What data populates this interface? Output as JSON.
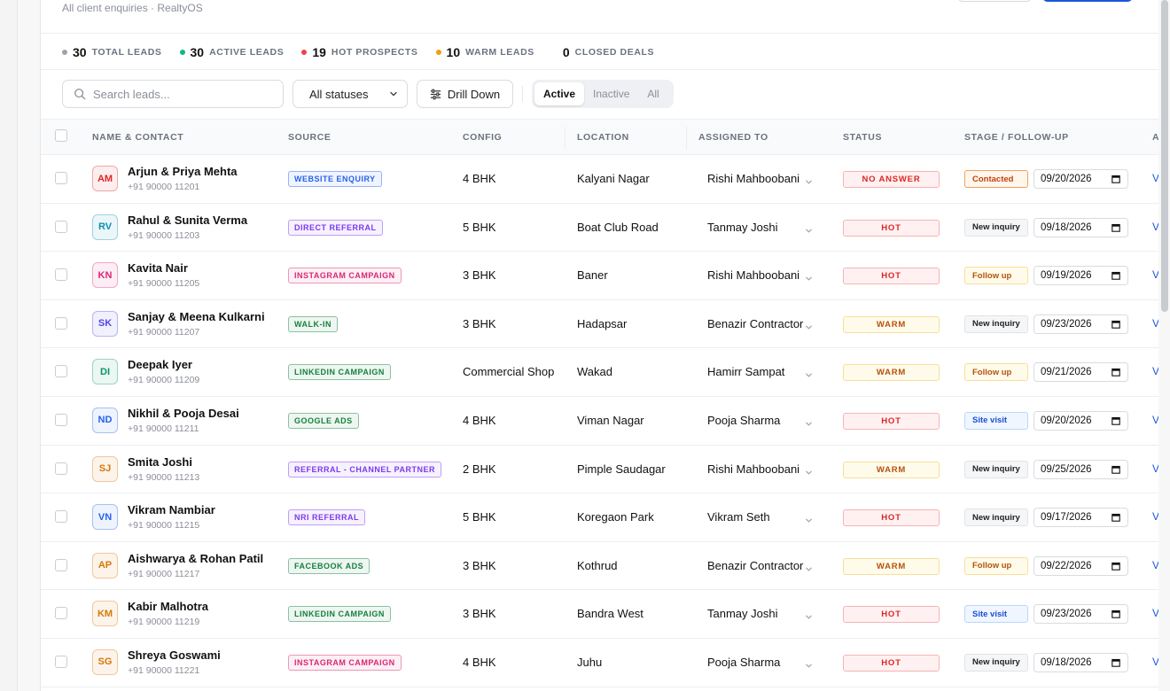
{
  "header": {
    "subtitle": "All client enquiries · RealtyOS"
  },
  "stats": [
    {
      "count": "30",
      "label": "TOTAL LEADS",
      "color": "#9ca3af"
    },
    {
      "count": "30",
      "label": "ACTIVE LEADS",
      "color": "#10b981"
    },
    {
      "count": "19",
      "label": "HOT PROSPECTS",
      "color": "#ef4444"
    },
    {
      "count": "10",
      "label": "WARM LEADS",
      "color": "#f59e0b"
    },
    {
      "count": "0",
      "label": "CLOSED DEALS",
      "color": ""
    }
  ],
  "toolbar": {
    "search_placeholder": "Search leads...",
    "status_filter": "All statuses",
    "drill_down_label": "Drill Down",
    "segments": [
      "Active",
      "Inactive",
      "All"
    ],
    "active_segment": "Active"
  },
  "table": {
    "columns": [
      "NAME & CONTACT",
      "SOURCE",
      "CONFIG",
      "LOCATION",
      "ASSIGNED TO",
      "STATUS",
      "STAGE / FOLLOW-UP",
      "A"
    ],
    "action_label": "V",
    "rows": [
      {
        "initials": "AM",
        "avatar_color": "#dc2626",
        "name": "Arjun & Priya Mehta",
        "phone": "+91 90000 11201",
        "source": "WEBSITE ENQUIRY",
        "source_color": "#2563eb",
        "config": "4 BHK",
        "location": "Kalyani Nagar",
        "assigned": "Rishi Mahboobani",
        "status": "NO ANSWER",
        "status_type": "noans",
        "stage": "Contacted",
        "stage_type": "contacted",
        "date": "09/20/2026"
      },
      {
        "initials": "RV",
        "avatar_color": "#0891b2",
        "name": "Rahul & Sunita Verma",
        "phone": "+91 90000 11203",
        "source": "DIRECT REFERRAL",
        "source_color": "#7c3aed",
        "config": "5 BHK",
        "location": "Boat Club Road",
        "assigned": "Tanmay Joshi",
        "status": "HOT",
        "status_type": "hot",
        "stage": "New inquiry",
        "stage_type": "newinq",
        "date": "09/18/2026"
      },
      {
        "initials": "KN",
        "avatar_color": "#db2777",
        "name": "Kavita Nair",
        "phone": "+91 90000 11205",
        "source": "INSTAGRAM CAMPAIGN",
        "source_color": "#db2777",
        "config": "3 BHK",
        "location": "Baner",
        "assigned": "Rishi Mahboobani",
        "status": "HOT",
        "status_type": "hot",
        "stage": "Follow up",
        "stage_type": "followup",
        "date": "09/19/2026"
      },
      {
        "initials": "SK",
        "avatar_color": "#4f46e5",
        "name": "Sanjay & Meena Kulkarni",
        "phone": "+91 90000 11207",
        "source": "WALK-IN",
        "source_color": "#15803d",
        "config": "3 BHK",
        "location": "Hadapsar",
        "assigned": "Benazir Contractor",
        "status": "WARM",
        "status_type": "warm",
        "stage": "New inquiry",
        "stage_type": "newinq",
        "date": "09/23/2026"
      },
      {
        "initials": "DI",
        "avatar_color": "#059669",
        "name": "Deepak Iyer",
        "phone": "+91 90000 11209",
        "source": "LINKEDIN CAMPAIGN",
        "source_color": "#15803d",
        "config": "Commercial Shop",
        "location": "Wakad",
        "assigned": "Hamirr Sampat",
        "status": "WARM",
        "status_type": "warm",
        "stage": "Follow up",
        "stage_type": "followup",
        "date": "09/21/2026"
      },
      {
        "initials": "ND",
        "avatar_color": "#2563eb",
        "name": "Nikhil & Pooja Desai",
        "phone": "+91 90000 11211",
        "source": "GOOGLE ADS",
        "source_color": "#15803d",
        "config": "4 BHK",
        "location": "Viman Nagar",
        "assigned": "Pooja Sharma",
        "status": "HOT",
        "status_type": "hot",
        "stage": "Site visit",
        "stage_type": "sitevisit",
        "date": "09/20/2026"
      },
      {
        "initials": "SJ",
        "avatar_color": "#d97706",
        "name": "Smita Joshi",
        "phone": "+91 90000 11213",
        "source": "REFERRAL - CHANNEL PARTNER",
        "source_color": "#7c3aed",
        "config": "2 BHK",
        "location": "Pimple Saudagar",
        "assigned": "Rishi Mahboobani",
        "status": "WARM",
        "status_type": "warm",
        "stage": "New inquiry",
        "stage_type": "newinq",
        "date": "09/25/2026"
      },
      {
        "initials": "VN",
        "avatar_color": "#2563eb",
        "name": "Vikram Nambiar",
        "phone": "+91 90000 11215",
        "source": "NRI REFERRAL",
        "source_color": "#7c3aed",
        "config": "5 BHK",
        "location": "Koregaon Park",
        "assigned": "Vikram Seth",
        "status": "HOT",
        "status_type": "hot",
        "stage": "New inquiry",
        "stage_type": "newinq",
        "date": "09/17/2026"
      },
      {
        "initials": "AP",
        "avatar_color": "#d97706",
        "name": "Aishwarya & Rohan Patil",
        "phone": "+91 90000 11217",
        "source": "FACEBOOK ADS",
        "source_color": "#15803d",
        "config": "3 BHK",
        "location": "Kothrud",
        "assigned": "Benazir Contractor",
        "status": "WARM",
        "status_type": "warm",
        "stage": "Follow up",
        "stage_type": "followup",
        "date": "09/22/2026"
      },
      {
        "initials": "KM",
        "avatar_color": "#d97706",
        "name": "Kabir Malhotra",
        "phone": "+91 90000 11219",
        "source": "LINKEDIN CAMPAIGN",
        "source_color": "#15803d",
        "config": "3 BHK",
        "location": "Bandra West",
        "assigned": "Tanmay Joshi",
        "status": "HOT",
        "status_type": "hot",
        "stage": "Site visit",
        "stage_type": "sitevisit",
        "date": "09/23/2026"
      },
      {
        "initials": "SG",
        "avatar_color": "#d97706",
        "name": "Shreya Goswami",
        "phone": "+91 90000 11221",
        "source": "INSTAGRAM CAMPAIGN",
        "source_color": "#db2777",
        "config": "4 BHK",
        "location": "Juhu",
        "assigned": "Pooja Sharma",
        "status": "HOT",
        "status_type": "hot",
        "stage": "New inquiry",
        "stage_type": "newinq",
        "date": "09/18/2026"
      }
    ]
  }
}
